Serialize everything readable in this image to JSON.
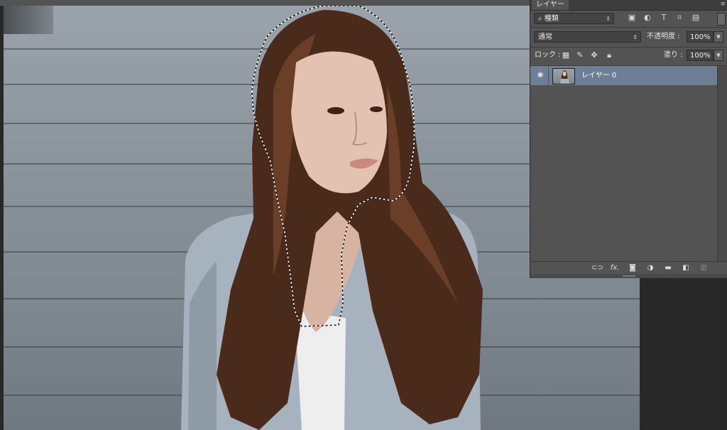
{
  "document": {
    "description_free": true
  },
  "layers_panel": {
    "tab_label": "レイヤー",
    "filter_dropdown": "種類",
    "filter_icons": [
      "image-icon",
      "adjustment-icon",
      "type-icon",
      "shape-icon",
      "smart-object-icon"
    ],
    "blend_mode": "通常",
    "opacity_label": "不透明度 :",
    "opacity_value": "100%",
    "lock_label": "ロック :",
    "fill_label": "塗り :",
    "fill_value": "100%",
    "layers": [
      {
        "name": "レイヤー 0",
        "visible": true,
        "selected": true
      }
    ],
    "bottom_icons": [
      "link-icon",
      "fx-icon",
      "mask-icon",
      "adjustment-layer-icon",
      "group-folder-icon",
      "new-layer-icon",
      "trash-icon"
    ],
    "fx_glyph": "fx.",
    "selected_row_color": "#6d7e96"
  },
  "colors": {
    "panel_bg": "#535353",
    "app_bg": "#282828",
    "hair": "#4a2a1a",
    "hoodie": "#a7b2bf"
  }
}
